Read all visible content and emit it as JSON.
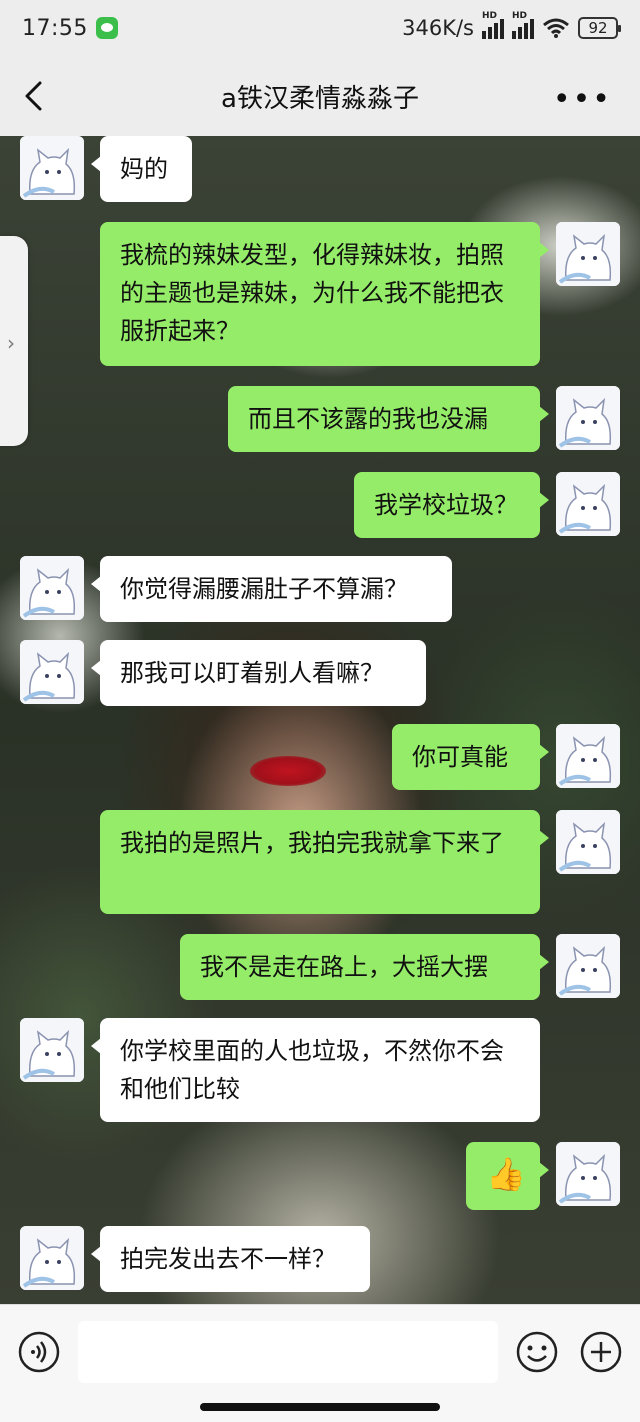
{
  "status_bar": {
    "time": "17:55",
    "net_speed": "346K/s",
    "signal_badge": "HD",
    "battery": "92"
  },
  "header": {
    "title": "a铁汉柔情淼淼子",
    "back_icon": "chevron-left-icon",
    "more_icon": "more-dots-icon"
  },
  "messages": [
    {
      "side": "in",
      "text": "妈的"
    },
    {
      "side": "out",
      "text": "我梳的辣妹发型，化得辣妹妆，拍照的主题也是辣妹，为什么我不能把衣服折起来？"
    },
    {
      "side": "out",
      "text": "而且不该露的我也没漏"
    },
    {
      "side": "out",
      "text": "我学校垃圾？"
    },
    {
      "side": "in",
      "text": "你觉得漏腰漏肚子不算漏？"
    },
    {
      "side": "in",
      "text": "那我可以盯着别人看嘛？"
    },
    {
      "side": "out",
      "text": "你可真能"
    },
    {
      "side": "out",
      "text": "我拍的是照片，我拍完我就拿下来了"
    },
    {
      "side": "out",
      "text": "我不是走在路上，大摇大摆"
    },
    {
      "side": "in",
      "text": "你学校里面的人也垃圾，不然你不会和他们比较"
    },
    {
      "side": "out",
      "text": "👍",
      "emoji": "thumbs-up-icon"
    },
    {
      "side": "in",
      "text": "拍完发出去不一样？"
    }
  ],
  "input_bar": {
    "voice_icon": "voice-icon",
    "emoji_icon": "emoji-icon",
    "plus_icon": "plus-icon",
    "value": ""
  },
  "colors": {
    "out_bubble": "#95ec69",
    "in_bubble": "#ffffff",
    "bar_bg": "#ededed"
  }
}
